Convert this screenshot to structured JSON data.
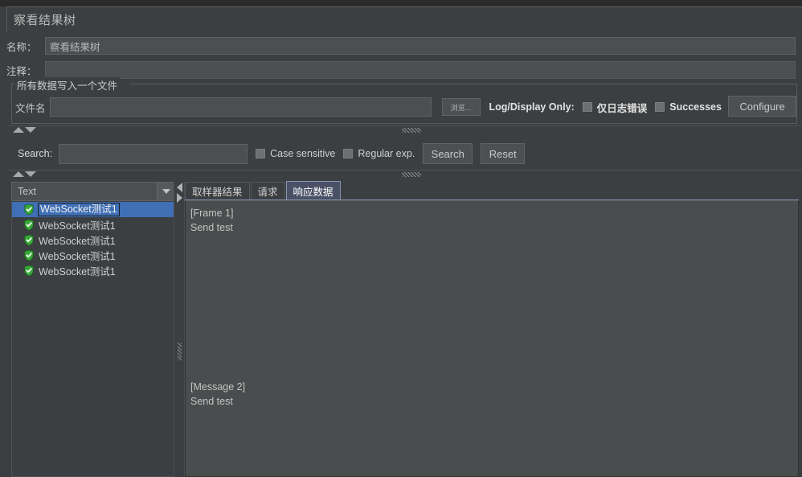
{
  "window": {
    "title": "察看结果树"
  },
  "form": {
    "name_label": "名称：",
    "name_value": "察看结果树",
    "comment_label": "注释：",
    "comment_value": ""
  },
  "file_group": {
    "title": "所有数据写入一个文件",
    "filename_label": "文件名",
    "filename_value": "",
    "browse_label": "浏览...",
    "log_display_label": "Log/Display Only:",
    "errors_only_label": "仅日志错误",
    "errors_only_checked": false,
    "successes_label": "Successes",
    "successes_checked": false,
    "configure_label": "Configure"
  },
  "search": {
    "label": "Search:",
    "value": "",
    "case_sensitive_label": "Case sensitive",
    "case_sensitive_checked": false,
    "regular_exp_label": "Regular exp.",
    "regular_exp_checked": false,
    "search_button": "Search",
    "reset_button": "Reset"
  },
  "results": {
    "renderer_selected": "Text",
    "tree_items": [
      {
        "label": "WebSocket测试1",
        "status": "success",
        "selected": true
      },
      {
        "label": "WebSocket测试1",
        "status": "success",
        "selected": false
      },
      {
        "label": "WebSocket测试1",
        "status": "success",
        "selected": false
      },
      {
        "label": "WebSocket测试1",
        "status": "success",
        "selected": false
      },
      {
        "label": "WebSocket测试1",
        "status": "success",
        "selected": false
      }
    ],
    "tabs": [
      {
        "label": "取样器结果",
        "active": false
      },
      {
        "label": "请求",
        "active": false
      },
      {
        "label": "响应数据",
        "active": true
      }
    ],
    "response_text": {
      "block1_line1": "[Frame 1]",
      "block1_line2": "Send test",
      "block2_line1": "[Message 2]",
      "block2_line2": "Send test"
    }
  },
  "colors": {
    "background": "#3c3f41",
    "panel": "#4a4d4e",
    "selection_blue": "#3f6fb5",
    "tab_active": "#4a5166",
    "status_success_green": "#3aa93a",
    "text_primary": "#cfcfcf"
  }
}
